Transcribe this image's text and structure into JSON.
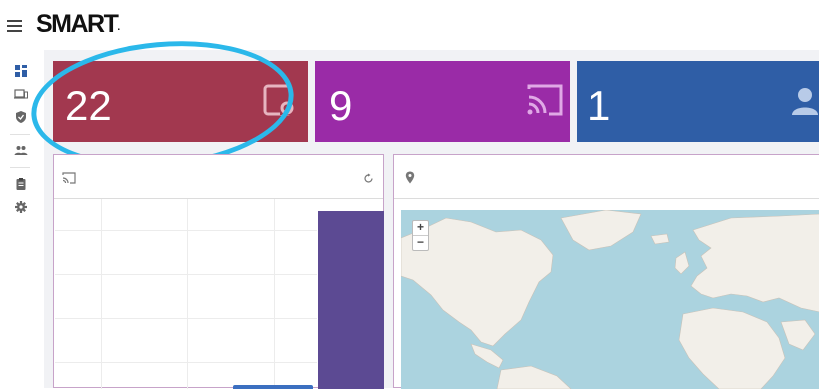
{
  "header": {
    "logo_text": "SMART",
    "logo_dot": "."
  },
  "sidebar": {
    "items": [
      {
        "icon": "dashboard-icon"
      },
      {
        "icon": "devices-icon"
      },
      {
        "icon": "shield-icon"
      },
      {
        "icon": "users-icon"
      },
      {
        "icon": "clipboard-icon"
      },
      {
        "icon": "gear-icon"
      }
    ]
  },
  "tiles": [
    {
      "value": "22",
      "icon": "device-lock-icon",
      "color": "#a2384f"
    },
    {
      "value": "9",
      "icon": "cast-icon",
      "color": "#9a2ba7"
    },
    {
      "value": "1",
      "icon": "users-icon",
      "color": "#2f5ea6"
    }
  ],
  "panels": {
    "left": {
      "header_icon": "cast-icon",
      "action_icon": "refresh-icon"
    },
    "right": {
      "header_icon": "map-pin-icon"
    },
    "map": {
      "zoom_in": "+",
      "zoom_out": "−"
    }
  },
  "colors": {
    "highlight": "#2bb8ea",
    "bar": "#5c4a93"
  }
}
